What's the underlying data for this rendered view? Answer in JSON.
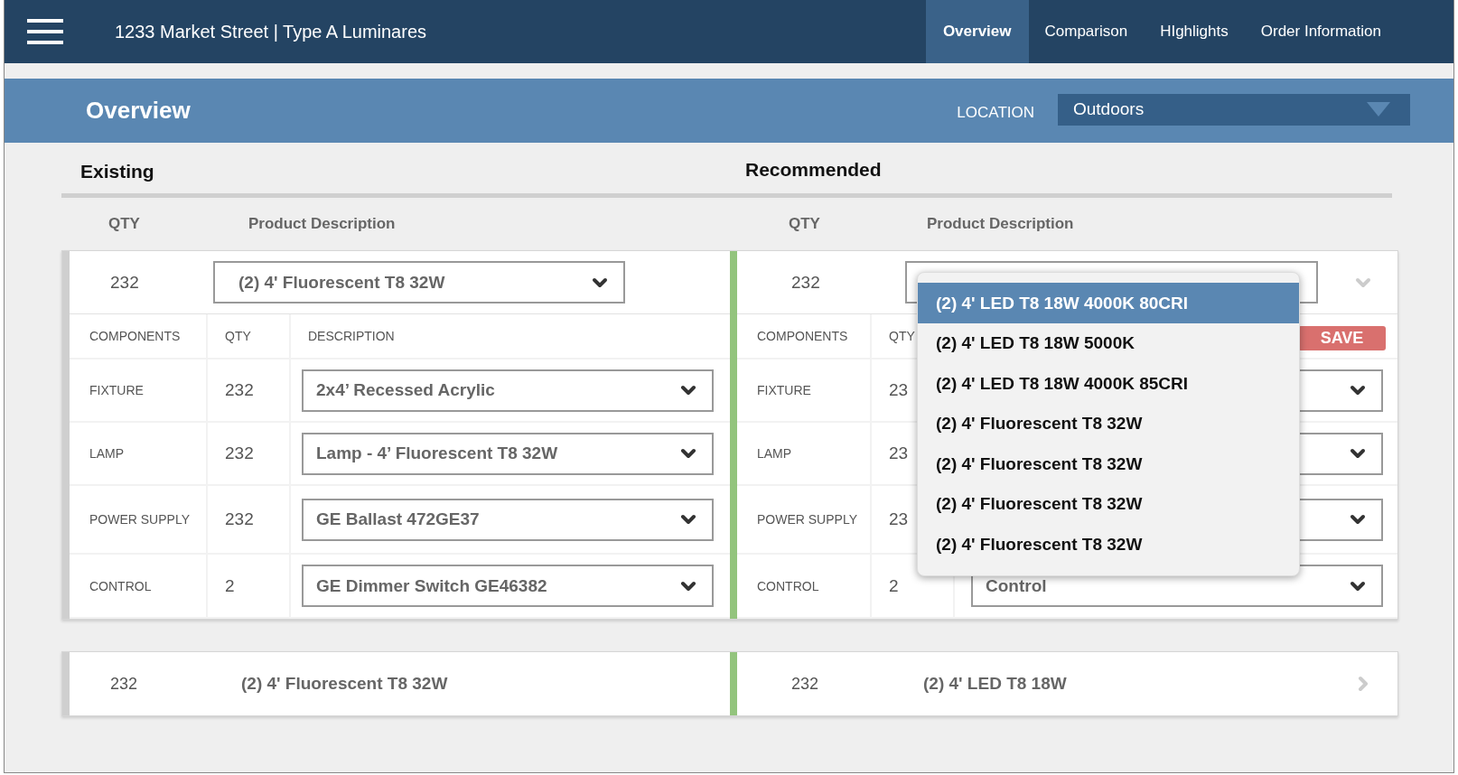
{
  "nav": {
    "title": "1233 Market Street | Type A Luminares",
    "tabs": [
      {
        "label": "Overview",
        "selected": true
      },
      {
        "label": "Comparison",
        "selected": false
      },
      {
        "label": "HIghlights",
        "selected": false
      },
      {
        "label": "Order Information",
        "selected": false
      }
    ]
  },
  "header": {
    "title": "Overview",
    "location_label": "LOCATION",
    "location_value": "Outdoors"
  },
  "sections": {
    "existing": "Existing",
    "recommended": "Recommended"
  },
  "columns": {
    "existing": [
      "QTY",
      "Product Description"
    ],
    "recommended": [
      "QTY",
      "Product Description"
    ]
  },
  "rows": [
    {
      "expanded": true,
      "existing": {
        "qty": "232",
        "product": "(2) 4' Fluorescent T8 32W"
      },
      "recommended": {
        "qty": "232"
      },
      "components": {
        "existing_headers": [
          "COMPONENTS",
          "QTY",
          "DESCRIPTION"
        ],
        "recommended_headers": [
          "COMPONENTS",
          "QTY"
        ],
        "save": "SAVE",
        "items": [
          {
            "existing": {
              "component": "FIXTURE",
              "qty": "232",
              "description": "2x4’ Recessed Acrylic"
            },
            "recommended": {
              "component": "FIXTURE",
              "qty": "23"
            }
          },
          {
            "existing": {
              "component": "LAMP",
              "qty": "232",
              "description": "Lamp - 4’ Fluorescent T8 32W"
            },
            "recommended": {
              "component": "LAMP",
              "qty": "23"
            }
          },
          {
            "existing": {
              "component": "POWER SUPPLY",
              "qty": "232",
              "description": "GE Ballast 472GE37"
            },
            "recommended": {
              "component": "POWER SUPPLY",
              "qty": "23"
            }
          },
          {
            "existing": {
              "component": "CONTROL",
              "qty": "2",
              "description": "GE Dimmer Switch GE46382"
            },
            "recommended": {
              "component": "CONTROL",
              "qty": "2",
              "description": "Control"
            }
          }
        ]
      },
      "dropdown": [
        {
          "label": "(2) 4' LED T8 18W 4000K 80CRI",
          "selected": true
        },
        {
          "label": "(2) 4' LED T8 18W 5000K",
          "selected": false
        },
        {
          "label": "(2) 4' LED T8 18W 4000K 85CRI",
          "selected": false
        },
        {
          "label": "(2) 4' Fluorescent T8 32W",
          "selected": false
        },
        {
          "label": "(2) 4' Fluorescent T8 32W",
          "selected": false
        },
        {
          "label": "(2) 4' Fluorescent T8 32W",
          "selected": false
        },
        {
          "label": "(2) 4' Fluorescent T8 32W",
          "selected": false
        }
      ]
    },
    {
      "expanded": false,
      "existing": {
        "qty": "232",
        "product": "(2) 4' Fluorescent T8 32W"
      },
      "recommended": {
        "qty": "232",
        "product": "(2) 4' LED T8 18W"
      }
    }
  ]
}
